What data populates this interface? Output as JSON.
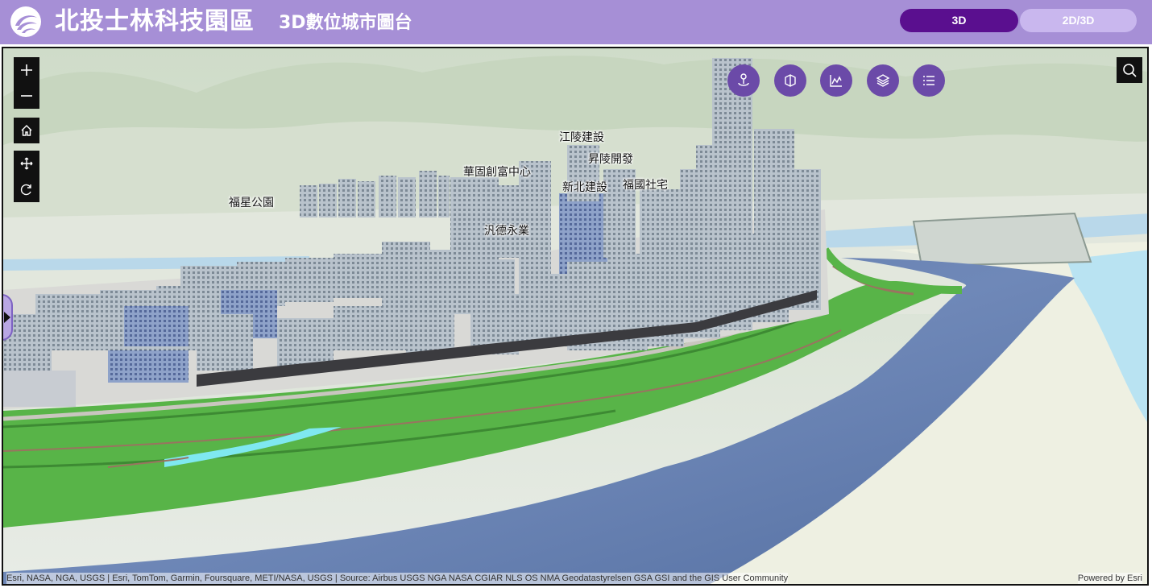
{
  "header": {
    "title": "北投士林科技園區",
    "subtitle": "3D數位城市圖台",
    "mode_buttons": [
      {
        "label": "3D",
        "active": true
      },
      {
        "label": "2D/3D",
        "active": false
      }
    ],
    "colors": {
      "bar": "#a68fd6",
      "active_button": "#5a0f8f",
      "inactive_button": "#c9b7ee",
      "tool_button": "#6b4aa8"
    }
  },
  "map": {
    "controls": [
      "zoom-in-icon",
      "zoom-out-icon",
      "home-icon",
      "pan-icon",
      "rotate-icon"
    ],
    "tools": [
      "pin-icon",
      "box-icon",
      "chart-icon",
      "layers-icon",
      "list-icon"
    ],
    "search_icon": "search-icon",
    "poi_labels": [
      "江陵建設",
      "昇陵開發",
      "華固創富中心",
      "新北建設",
      "福國社宅",
      "福星公園",
      "汎德永業"
    ],
    "attribution": "Esri, NASA, NGA, USGS | Esri, TomTom, Garmin, Foursquare, METI/NASA, USGS | Source: Airbus USGS NGA NASA CGIAR NLS OS NMA Geodatastyrelsen GSA GSI and the GIS User Community",
    "powered_by": "Powered by Esri"
  }
}
